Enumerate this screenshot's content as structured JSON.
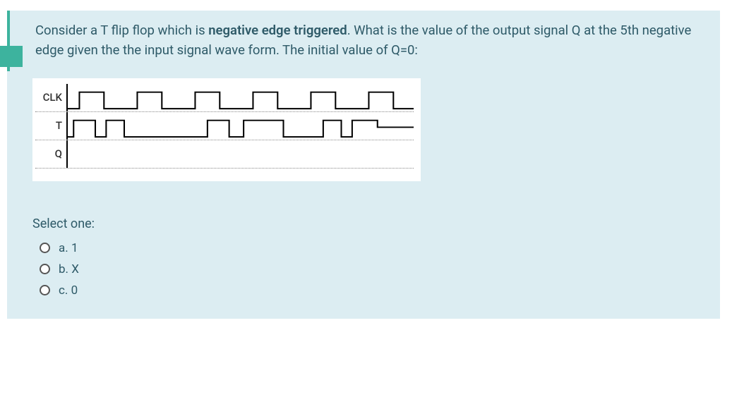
{
  "question": {
    "text_part1": "Consider a T flip flop which is ",
    "text_bold": "negative edge triggered",
    "text_part2": ". What is the value of the output signal Q at the 5th negative edge given the the input signal wave form. The initial value of Q=0:"
  },
  "signals": {
    "clk_label": "CLK",
    "t_label": "T",
    "q_label": "Q"
  },
  "answers": {
    "prompt": "Select one:",
    "options": [
      {
        "key": "a",
        "label": "a. 1"
      },
      {
        "key": "b",
        "label": "b. X"
      },
      {
        "key": "c",
        "label": "c. 0"
      }
    ]
  }
}
